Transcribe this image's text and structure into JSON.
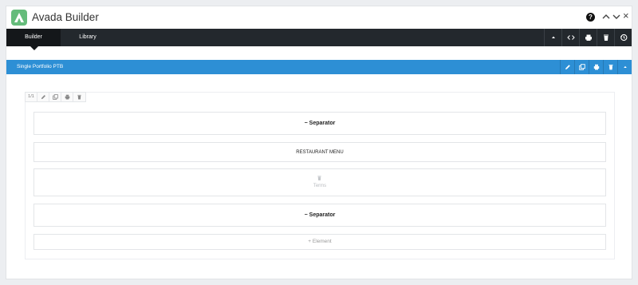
{
  "app": {
    "title": "Avada Builder",
    "help_label": "?",
    "close_label": "×"
  },
  "tabs": [
    {
      "label": "Builder",
      "active": true
    },
    {
      "label": "Library",
      "active": false
    }
  ],
  "toolbar_icons": [
    "caret-up-icon",
    "code-icon",
    "print-icon",
    "trash-icon",
    "history-icon"
  ],
  "section": {
    "title": "Single Portfolio PTB",
    "icons": [
      "pencil-icon",
      "clone-icon",
      "print-icon",
      "trash-icon",
      "caret-up-icon"
    ]
  },
  "column": {
    "size_label": "1/1"
  },
  "elements": [
    {
      "label": "Separator",
      "prefix": "−"
    },
    {
      "label": "RESTAURANT MENU"
    },
    {
      "label": "Terms"
    },
    {
      "label": "Separator",
      "prefix": "−"
    }
  ],
  "add_element": {
    "label": "+ Element"
  },
  "colors": {
    "accent": "#2d8fd5",
    "dark_bar": "#23282d",
    "logo": "#65bc7b"
  }
}
